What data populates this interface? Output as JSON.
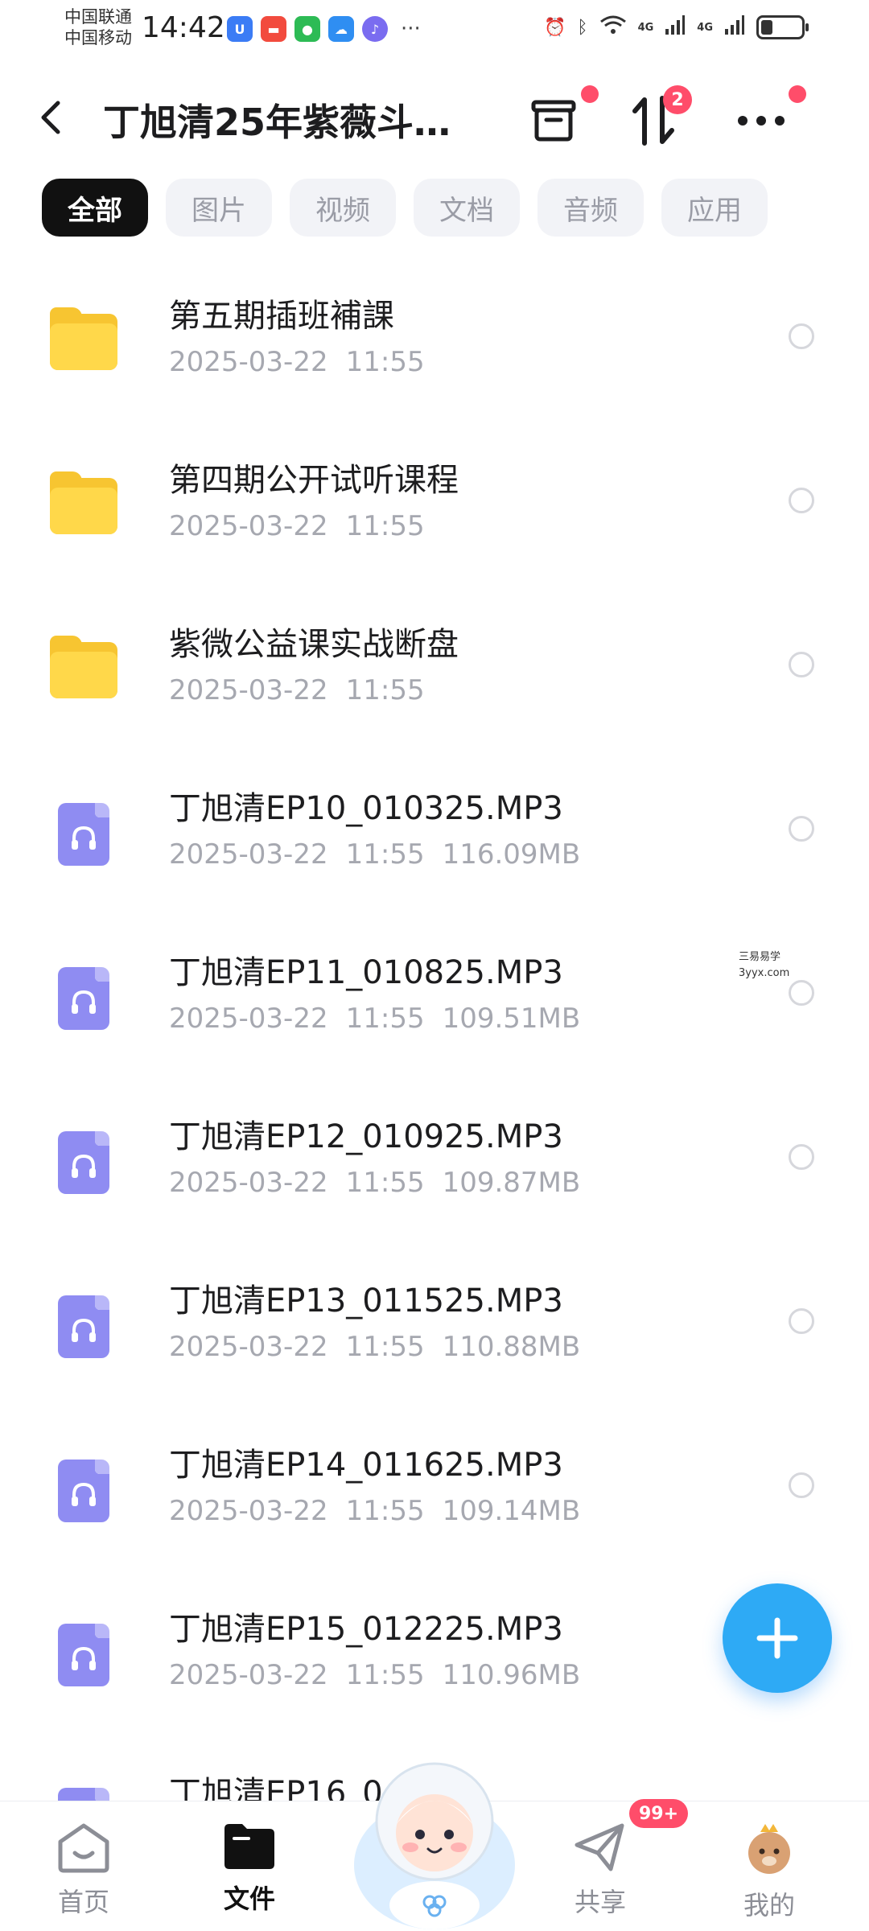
{
  "statusbar": {
    "carrier1": "中国联通",
    "carrier2": "中国移动",
    "time": "14:42",
    "net1": "4G",
    "net2": "4G",
    "battery_level": 0.3
  },
  "header": {
    "title": "丁旭清25年紫薇斗…",
    "transfer_badge": "2"
  },
  "filters": [
    {
      "label": "全部",
      "active": true
    },
    {
      "label": "图片",
      "active": false
    },
    {
      "label": "视频",
      "active": false
    },
    {
      "label": "文档",
      "active": false
    },
    {
      "label": "音频",
      "active": false
    },
    {
      "label": "应用",
      "active": false
    }
  ],
  "files": [
    {
      "type": "folder",
      "name": "第五期插班補課",
      "date": "2025-03-22",
      "time": "11:55",
      "size": ""
    },
    {
      "type": "folder",
      "name": "第四期公开试听课程",
      "date": "2025-03-22",
      "time": "11:55",
      "size": ""
    },
    {
      "type": "folder",
      "name": "紫微公益课实战断盘",
      "date": "2025-03-22",
      "time": "11:55",
      "size": ""
    },
    {
      "type": "audio",
      "name": "丁旭清EP10_010325.MP3",
      "date": "2025-03-22",
      "time": "11:55",
      "size": "116.09MB"
    },
    {
      "type": "audio",
      "name": "丁旭清EP11_010825.MP3",
      "date": "2025-03-22",
      "time": "11:55",
      "size": "109.51MB"
    },
    {
      "type": "audio",
      "name": "丁旭清EP12_010925.MP3",
      "date": "2025-03-22",
      "time": "11:55",
      "size": "109.87MB"
    },
    {
      "type": "audio",
      "name": "丁旭清EP13_011525.MP3",
      "date": "2025-03-22",
      "time": "11:55",
      "size": "110.88MB"
    },
    {
      "type": "audio",
      "name": "丁旭清EP14_011625.MP3",
      "date": "2025-03-22",
      "time": "11:55",
      "size": "109.14MB"
    },
    {
      "type": "audio",
      "name": "丁旭清EP15_012225.MP3",
      "date": "2025-03-22",
      "time": "11:55",
      "size": "110.96MB"
    },
    {
      "type": "audio",
      "name": "丁旭清EP16_0",
      "date": "",
      "time": "",
      "size": ""
    }
  ],
  "watermark": {
    "line1": "三易易学",
    "line2": "3yyx.com"
  },
  "bottomnav": {
    "home": "首页",
    "files": "文件",
    "share": "共享",
    "mine": "我的",
    "share_badge": "99+"
  },
  "colors": {
    "accent": "#2eaaf5",
    "folder": "#ffd84a",
    "audio": "#8f8cf2",
    "badge": "#ff4d6a"
  }
}
